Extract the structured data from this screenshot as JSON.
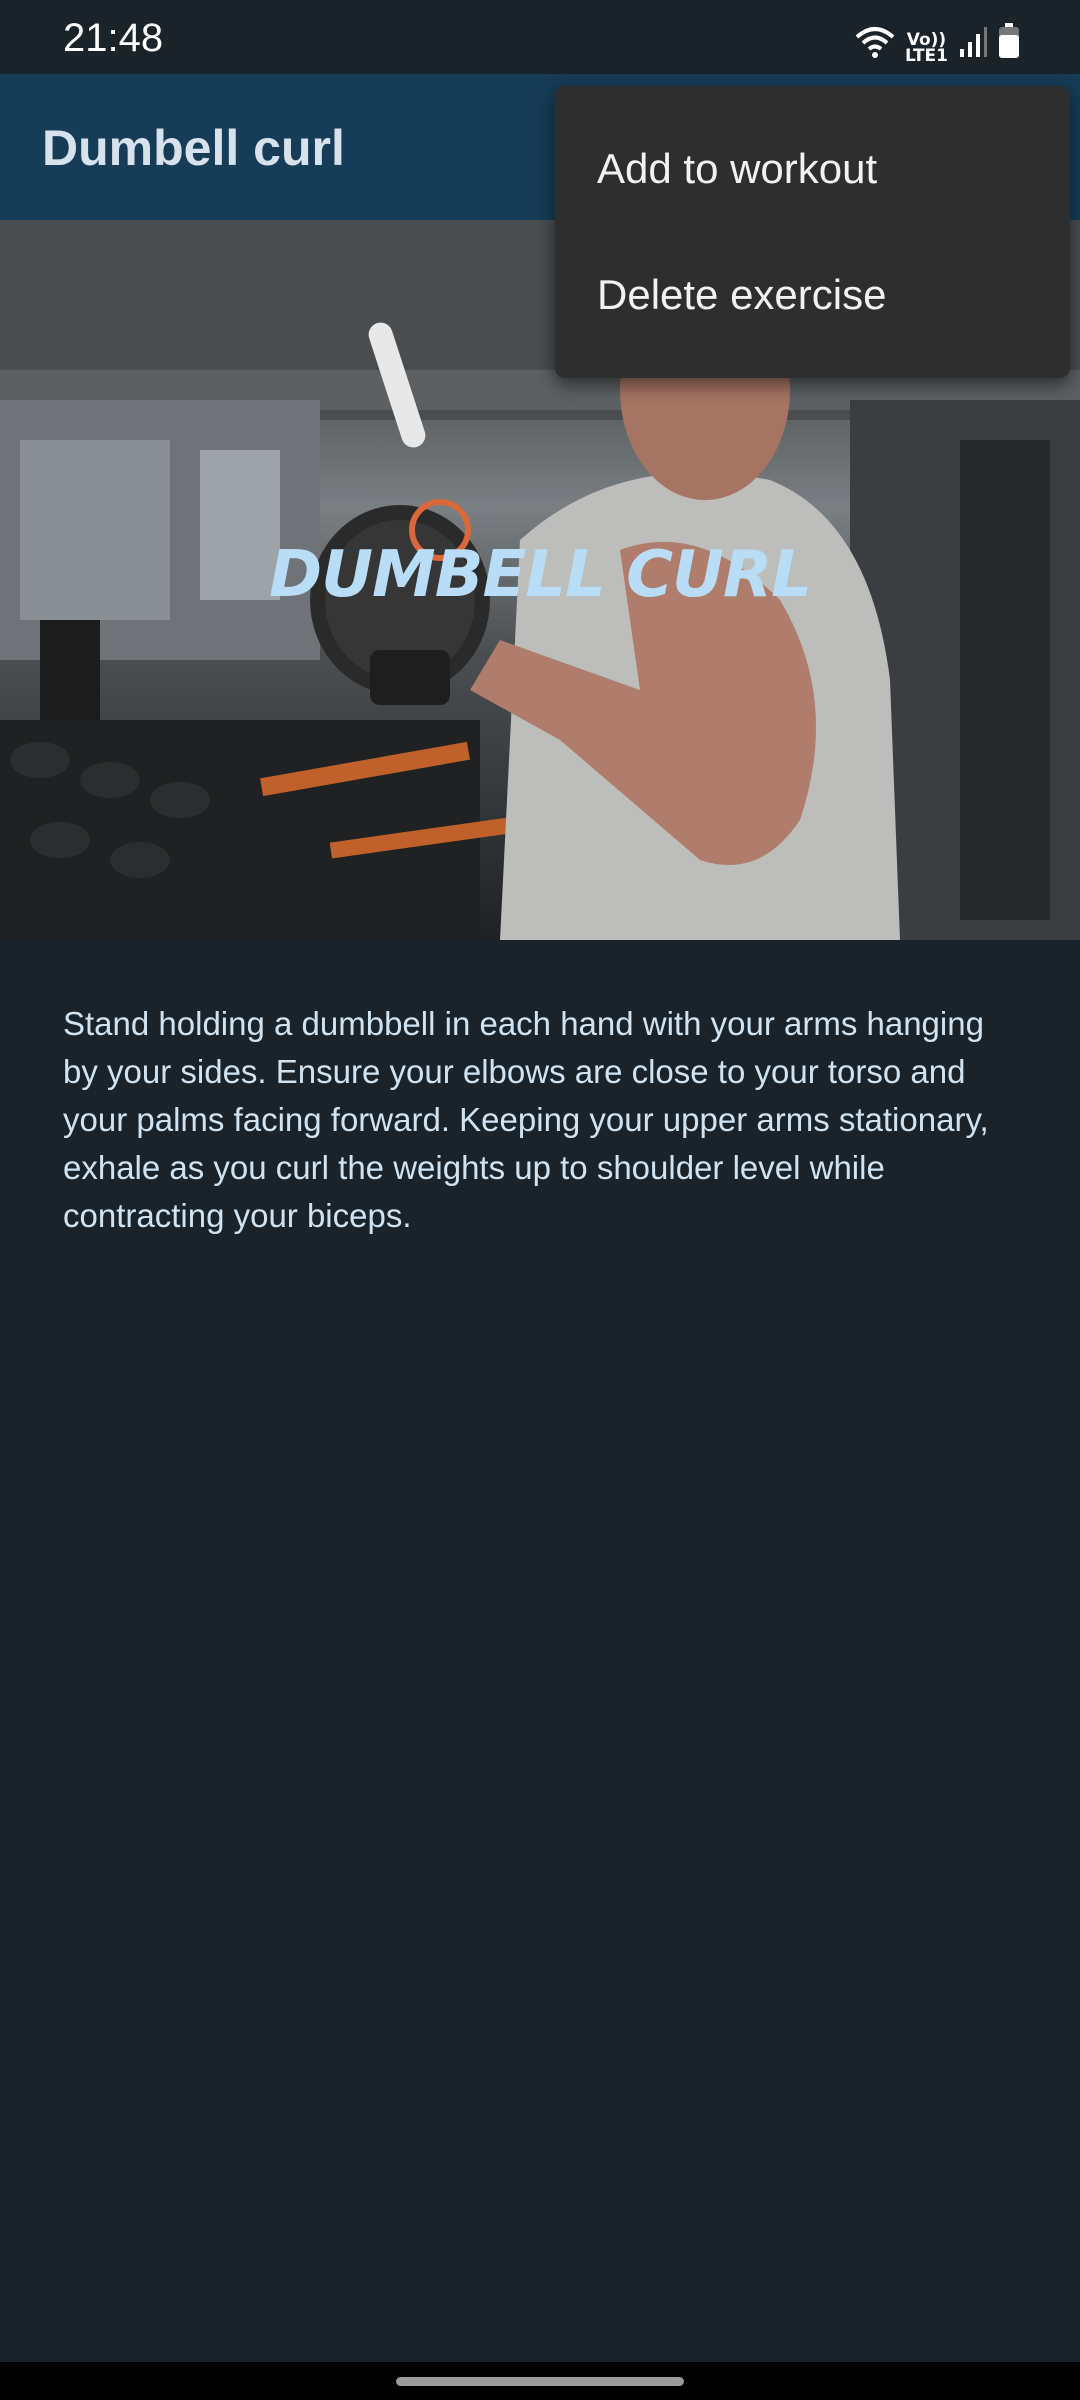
{
  "status_bar": {
    "time": "21:48",
    "network_label_top": "Vo))",
    "network_label_bottom": "LTE1",
    "icons": [
      "wifi-icon",
      "signal-icon",
      "battery-icon"
    ]
  },
  "app_bar": {
    "title": "Dumbell curl"
  },
  "menu": {
    "items": [
      {
        "label": "Add to workout"
      },
      {
        "label": "Delete exercise"
      }
    ]
  },
  "hero": {
    "overlay_text": "DUMBELL CURL",
    "overlay_color": "#b9dcf7"
  },
  "description": "Stand holding a dumbbell in each hand with your arms hanging by your sides. Ensure your elbows are close to your torso and your palms facing forward. Keeping your upper arms stationary, exhale as you curl the weights up to shoulder level while contracting your biceps.",
  "colors": {
    "background": "#1b232a",
    "app_bar": "#173c57",
    "menu_background": "#2e2e2e",
    "text_light": "#cfe3f2"
  }
}
